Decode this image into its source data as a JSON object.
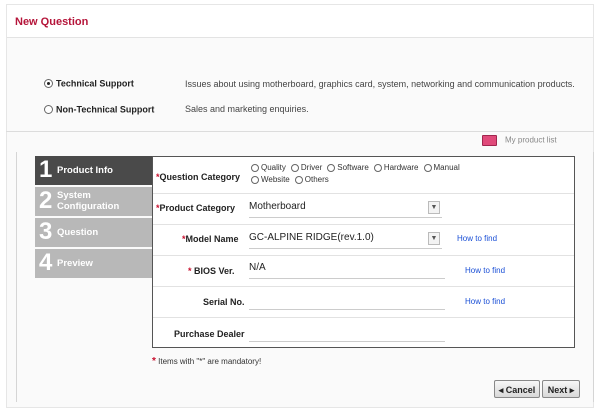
{
  "page_title": "New Question",
  "support_options": [
    {
      "label": "Technical Support",
      "description": "Issues about using motherboard, graphics card, system, networking and communication products.",
      "selected": true
    },
    {
      "label": "Non-Technical Support",
      "description": "Sales and marketing enquiries.",
      "selected": false
    }
  ],
  "my_product_list": "My product list",
  "steps": [
    {
      "num": "1",
      "label": "Product Info",
      "active": true
    },
    {
      "num": "2",
      "label_line1": "System",
      "label_line2": "Configuration",
      "active": false
    },
    {
      "num": "3",
      "label": "Question",
      "active": false
    },
    {
      "num": "4",
      "label": "Preview",
      "active": false
    }
  ],
  "form": {
    "question_category": {
      "label": "Question Category",
      "options": [
        "Quality",
        "Driver",
        "Software",
        "Hardware",
        "Manual",
        "Website",
        "Others"
      ]
    },
    "product_category": {
      "label": "Product Category",
      "value": "Motherboard"
    },
    "model_name": {
      "label": "Model Name",
      "value": "GC-ALPINE RIDGE(rev.1.0)",
      "help": "How to find"
    },
    "bios_ver": {
      "label": "BIOS Ver.",
      "value": "N/A",
      "help": "How to find"
    },
    "serial_no": {
      "label": "Serial No.",
      "value": "",
      "help": "How to find"
    },
    "purchase_dealer": {
      "label": "Purchase Dealer",
      "value": ""
    },
    "required_marker": "*"
  },
  "mandatory_note": "Items with \"*\" are mandatory!",
  "buttons": {
    "cancel": "◂ Cancel",
    "next": "Next ▸"
  },
  "colors": {
    "accent": "#b5153a",
    "link": "#1a4fd6",
    "step_active": "#4a4a4a",
    "step_inactive": "#b8b8b8"
  },
  "icons": {
    "my_product_list": "product-list-icon",
    "dropdown": "chevron-down-icon"
  }
}
